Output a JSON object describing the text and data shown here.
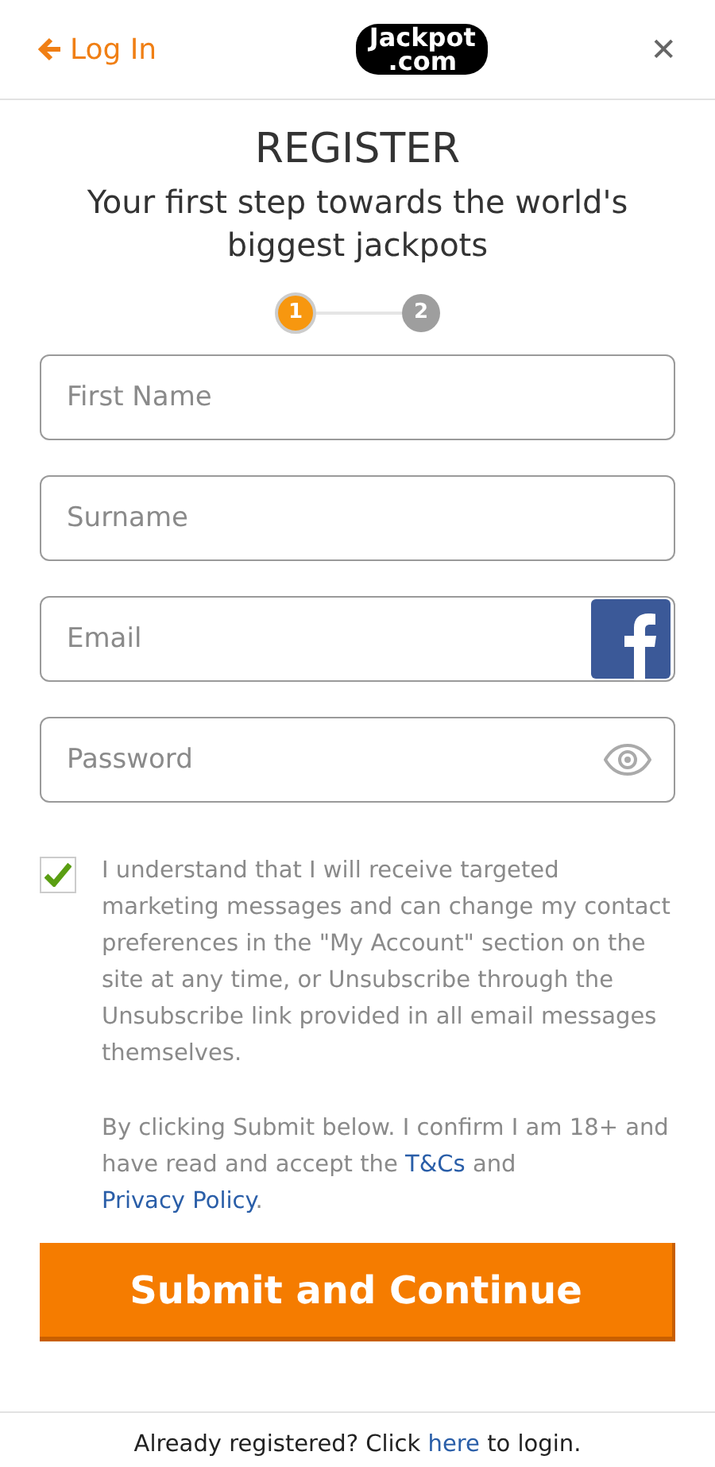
{
  "header": {
    "back_label": "Log In",
    "logo": [
      "Jackpot",
      ".com"
    ],
    "close": "✕"
  },
  "title": "REGISTER",
  "subtitle": "Your first step towards the world's biggest jackpots",
  "steps": [
    {
      "label": "1",
      "selected": true
    },
    {
      "label": "2",
      "selected": false
    }
  ],
  "fields": [
    {
      "placeholder": "First Name",
      "kind": "text"
    },
    {
      "placeholder": "Surname",
      "kind": "text"
    },
    {
      "placeholder": "Email",
      "kind": "facebook"
    },
    {
      "placeholder": "Password",
      "kind": "password"
    }
  ],
  "consent": {
    "checked": true,
    "text": "I understand that I will receive targeted marketing messages and can change my contact preferences in the \"My Account\" section on the site at any time, or Unsubscribe through the Unsubscribe link provided in all email messages themselves."
  },
  "legal": [
    {
      "kind": "text",
      "text": "By clicking Submit below. I confirm I am 18+ and have read and accept the "
    },
    {
      "kind": "link",
      "text": "T&Cs"
    },
    {
      "kind": "text",
      "text": " and "
    },
    {
      "kind": "link",
      "text": "Privacy Policy"
    },
    {
      "kind": "text",
      "text": "."
    }
  ],
  "submit": "Submit and Continue",
  "footer": [
    {
      "kind": "text",
      "text": "Already registered? Click "
    },
    {
      "kind": "link",
      "text": "here"
    },
    {
      "kind": "text",
      "text": " to login."
    }
  ]
}
